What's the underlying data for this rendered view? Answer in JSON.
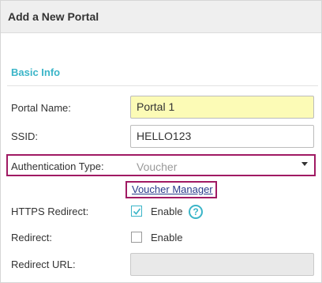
{
  "dialog": {
    "title": "Add a New Portal"
  },
  "section": {
    "title": "Basic Info"
  },
  "fields": {
    "portal_name": {
      "label": "Portal Name:",
      "value": "Portal 1"
    },
    "ssid": {
      "label": "SSID:",
      "value": "HELLO123"
    },
    "auth_type": {
      "label": "Authentication Type:",
      "value": "Voucher"
    },
    "voucher_manager": {
      "label": "Voucher Manager"
    },
    "https_redirect": {
      "label": "HTTPS Redirect:",
      "option": "Enable",
      "checked": true
    },
    "redirect": {
      "label": "Redirect:",
      "option": "Enable",
      "checked": false
    },
    "redirect_url": {
      "label": "Redirect URL:",
      "value": ""
    }
  },
  "icons": {
    "help": "question-circle-icon",
    "dropdown": "caret-down-icon",
    "check": "checkmark-icon"
  },
  "colors": {
    "accent": "#3bb5c8",
    "highlight_border": "#a01a63",
    "link": "#2a3b8c",
    "input_highlight": "#fcfbb6"
  }
}
